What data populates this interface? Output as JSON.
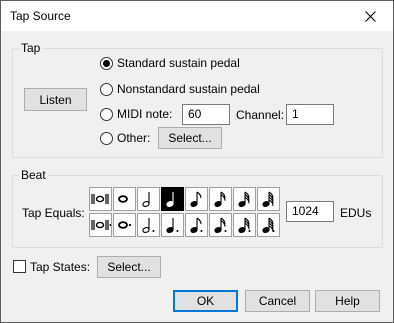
{
  "window": {
    "title": "Tap Source"
  },
  "tap_group": {
    "label": "Tap",
    "listen_button": "Listen",
    "options": [
      {
        "label": "Standard sustain pedal",
        "checked": true
      },
      {
        "label": "Nonstandard sustain pedal",
        "checked": false
      },
      {
        "label": "MIDI note:",
        "checked": false
      },
      {
        "label": "Other:",
        "checked": false
      }
    ],
    "midi_note_value": "60",
    "channel_label": "Channel:",
    "channel_value": "1",
    "other_select_button": "Select..."
  },
  "beat_group": {
    "label": "Beat",
    "tap_equals_label": "Tap Equals:",
    "row1": [
      "double-whole-note-icon",
      "whole-note-icon",
      "half-note-icon",
      "quarter-note-icon",
      "eighth-note-icon",
      "sixteenth-note-icon",
      "thirty-second-note-icon",
      "sixty-fourth-note-icon"
    ],
    "row2": [
      "dotted-double-whole-note-icon",
      "dotted-whole-note-icon",
      "dotted-half-note-icon",
      "dotted-quarter-note-icon",
      "dotted-eighth-note-icon",
      "dotted-sixteenth-note-icon",
      "dotted-thirty-second-note-icon",
      "dotted-sixty-fourth-note-icon"
    ],
    "selected_duration": "quarter-note-icon",
    "edus_value": "1024",
    "edus_label": "EDUs"
  },
  "tap_states": {
    "label": "Tap States:",
    "checked": false,
    "select_button": "Select..."
  },
  "footer": {
    "ok": "OK",
    "cancel": "Cancel",
    "help": "Help"
  },
  "colors": {
    "dialog_bg": "#f0f0f0",
    "button_bg": "#e1e1e1",
    "default_border": "#0078d7",
    "selected_duration_bg": "#000000"
  }
}
